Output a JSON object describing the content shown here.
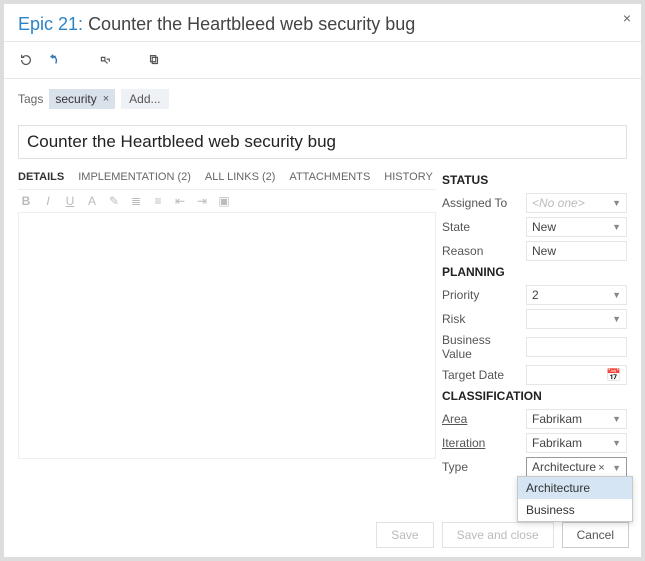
{
  "header": {
    "prefix": "Epic 21:",
    "title": "Counter the Heartbleed web security bug"
  },
  "tags": {
    "label": "Tags",
    "items": [
      "security"
    ],
    "add": "Add..."
  },
  "title_field": "Counter the Heartbleed web security bug",
  "tabs": {
    "details": "DETAILS",
    "implementation": "IMPLEMENTATION (2)",
    "all_links": "ALL LINKS (2)",
    "attachments": "ATTACHMENTS",
    "history": "HISTORY"
  },
  "status": {
    "heading": "STATUS",
    "assigned_label": "Assigned To",
    "assigned_placeholder": "<No one>",
    "state_label": "State",
    "state_value": "New",
    "reason_label": "Reason",
    "reason_value": "New"
  },
  "planning": {
    "heading": "PLANNING",
    "priority_label": "Priority",
    "priority_value": "2",
    "risk_label": "Risk",
    "risk_value": "",
    "bv_label": "Business Value",
    "bv_value": "",
    "target_label": "Target Date",
    "target_value": ""
  },
  "classification": {
    "heading": "CLASSIFICATION",
    "area_label": "Area",
    "area_value": "Fabrikam",
    "iteration_label": "Iteration",
    "iteration_value": "Fabrikam",
    "type_label": "Type",
    "type_value": "Architecture",
    "type_options": [
      "Architecture",
      "Business"
    ]
  },
  "footer": {
    "save": "Save",
    "save_close": "Save and close",
    "cancel": "Cancel"
  }
}
